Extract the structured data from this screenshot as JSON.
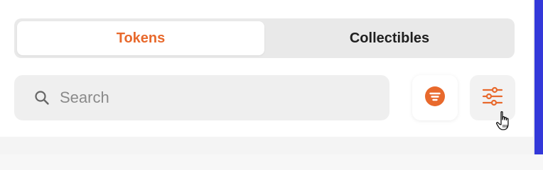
{
  "tabs": [
    {
      "label": "Tokens",
      "active": true
    },
    {
      "label": "Collectibles",
      "active": false
    }
  ],
  "search": {
    "placeholder": "Search",
    "value": "",
    "icon": "search-icon"
  },
  "actions": {
    "sort": {
      "icon": "sort-icon"
    },
    "filter": {
      "icon": "filter-sliders-icon"
    }
  },
  "colors": {
    "accent": "#e8692c",
    "edge_accent": "#3338d9"
  }
}
